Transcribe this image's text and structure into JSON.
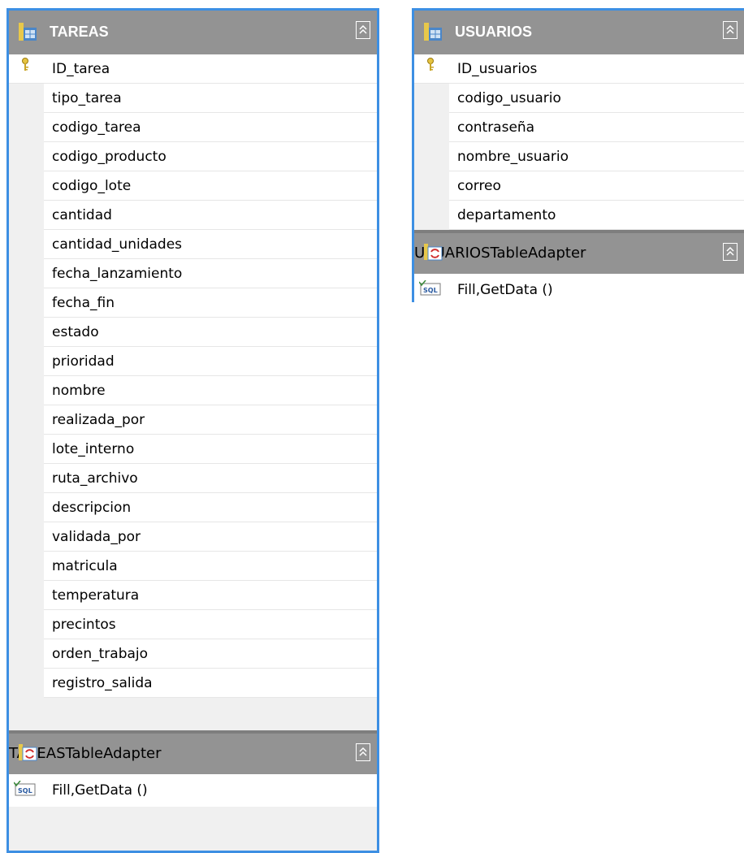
{
  "tables": {
    "tareas": {
      "name": "TAREAS",
      "key_column": "ID_tarea",
      "columns": [
        "tipo_tarea",
        "codigo_tarea",
        "codigo_producto",
        "codigo_lote",
        "cantidad",
        "cantidad_unidades",
        "fecha_lanzamiento",
        "fecha_fin",
        "estado",
        "prioridad",
        "nombre",
        "realizada_por",
        "lote_interno",
        "ruta_archivo",
        "descripcion",
        "validada_por",
        "matricula",
        "temperatura",
        "precintos",
        "orden_trabajo",
        "registro_salida"
      ],
      "adapter": {
        "name": "TAREASTableAdapter",
        "method": "Fill,GetData ()"
      }
    },
    "usuarios": {
      "name": "USUARIOS",
      "key_column": "ID_usuarios",
      "columns": [
        "codigo_usuario",
        "contraseña",
        "nombre_usuario",
        "correo",
        "departamento"
      ],
      "adapter": {
        "name": "USUARIOSTableAdapter",
        "method": "Fill,GetData ()"
      }
    }
  },
  "colors": {
    "border": "#3d8fe3",
    "header": "#939393",
    "panel": "#f0f0f0"
  }
}
